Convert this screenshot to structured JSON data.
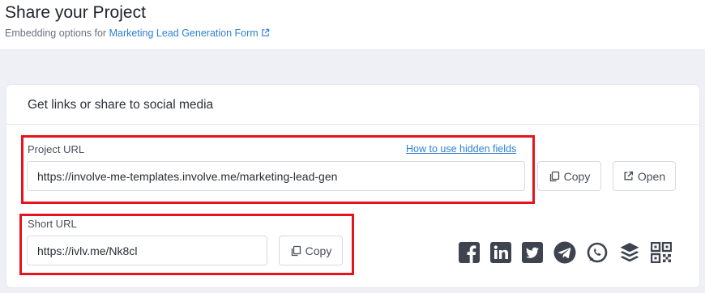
{
  "header": {
    "title": "Share your Project",
    "subtitle_prefix": "Embedding options for",
    "form_link": "Marketing Lead Generation Form"
  },
  "card": {
    "title": "Get links or share to social media",
    "project_url": {
      "label": "Project URL",
      "help_link": "How to use hidden fields",
      "value": "https://involve-me-templates.involve.me/marketing-lead-gen",
      "copy_label": "Copy",
      "open_label": "Open"
    },
    "short_url": {
      "label": "Short URL",
      "value": "https://ivlv.me/Nk8cl",
      "copy_label": "Copy"
    }
  },
  "social_icons": [
    "facebook-icon",
    "linkedin-icon",
    "twitter-icon",
    "telegram-icon",
    "whatsapp-icon",
    "buffer-icon",
    "qr-code-icon"
  ],
  "colors": {
    "link": "#2f80d1",
    "highlight": "#e4151f",
    "icon": "#3d4450",
    "page_bg": "#eef0f6"
  }
}
